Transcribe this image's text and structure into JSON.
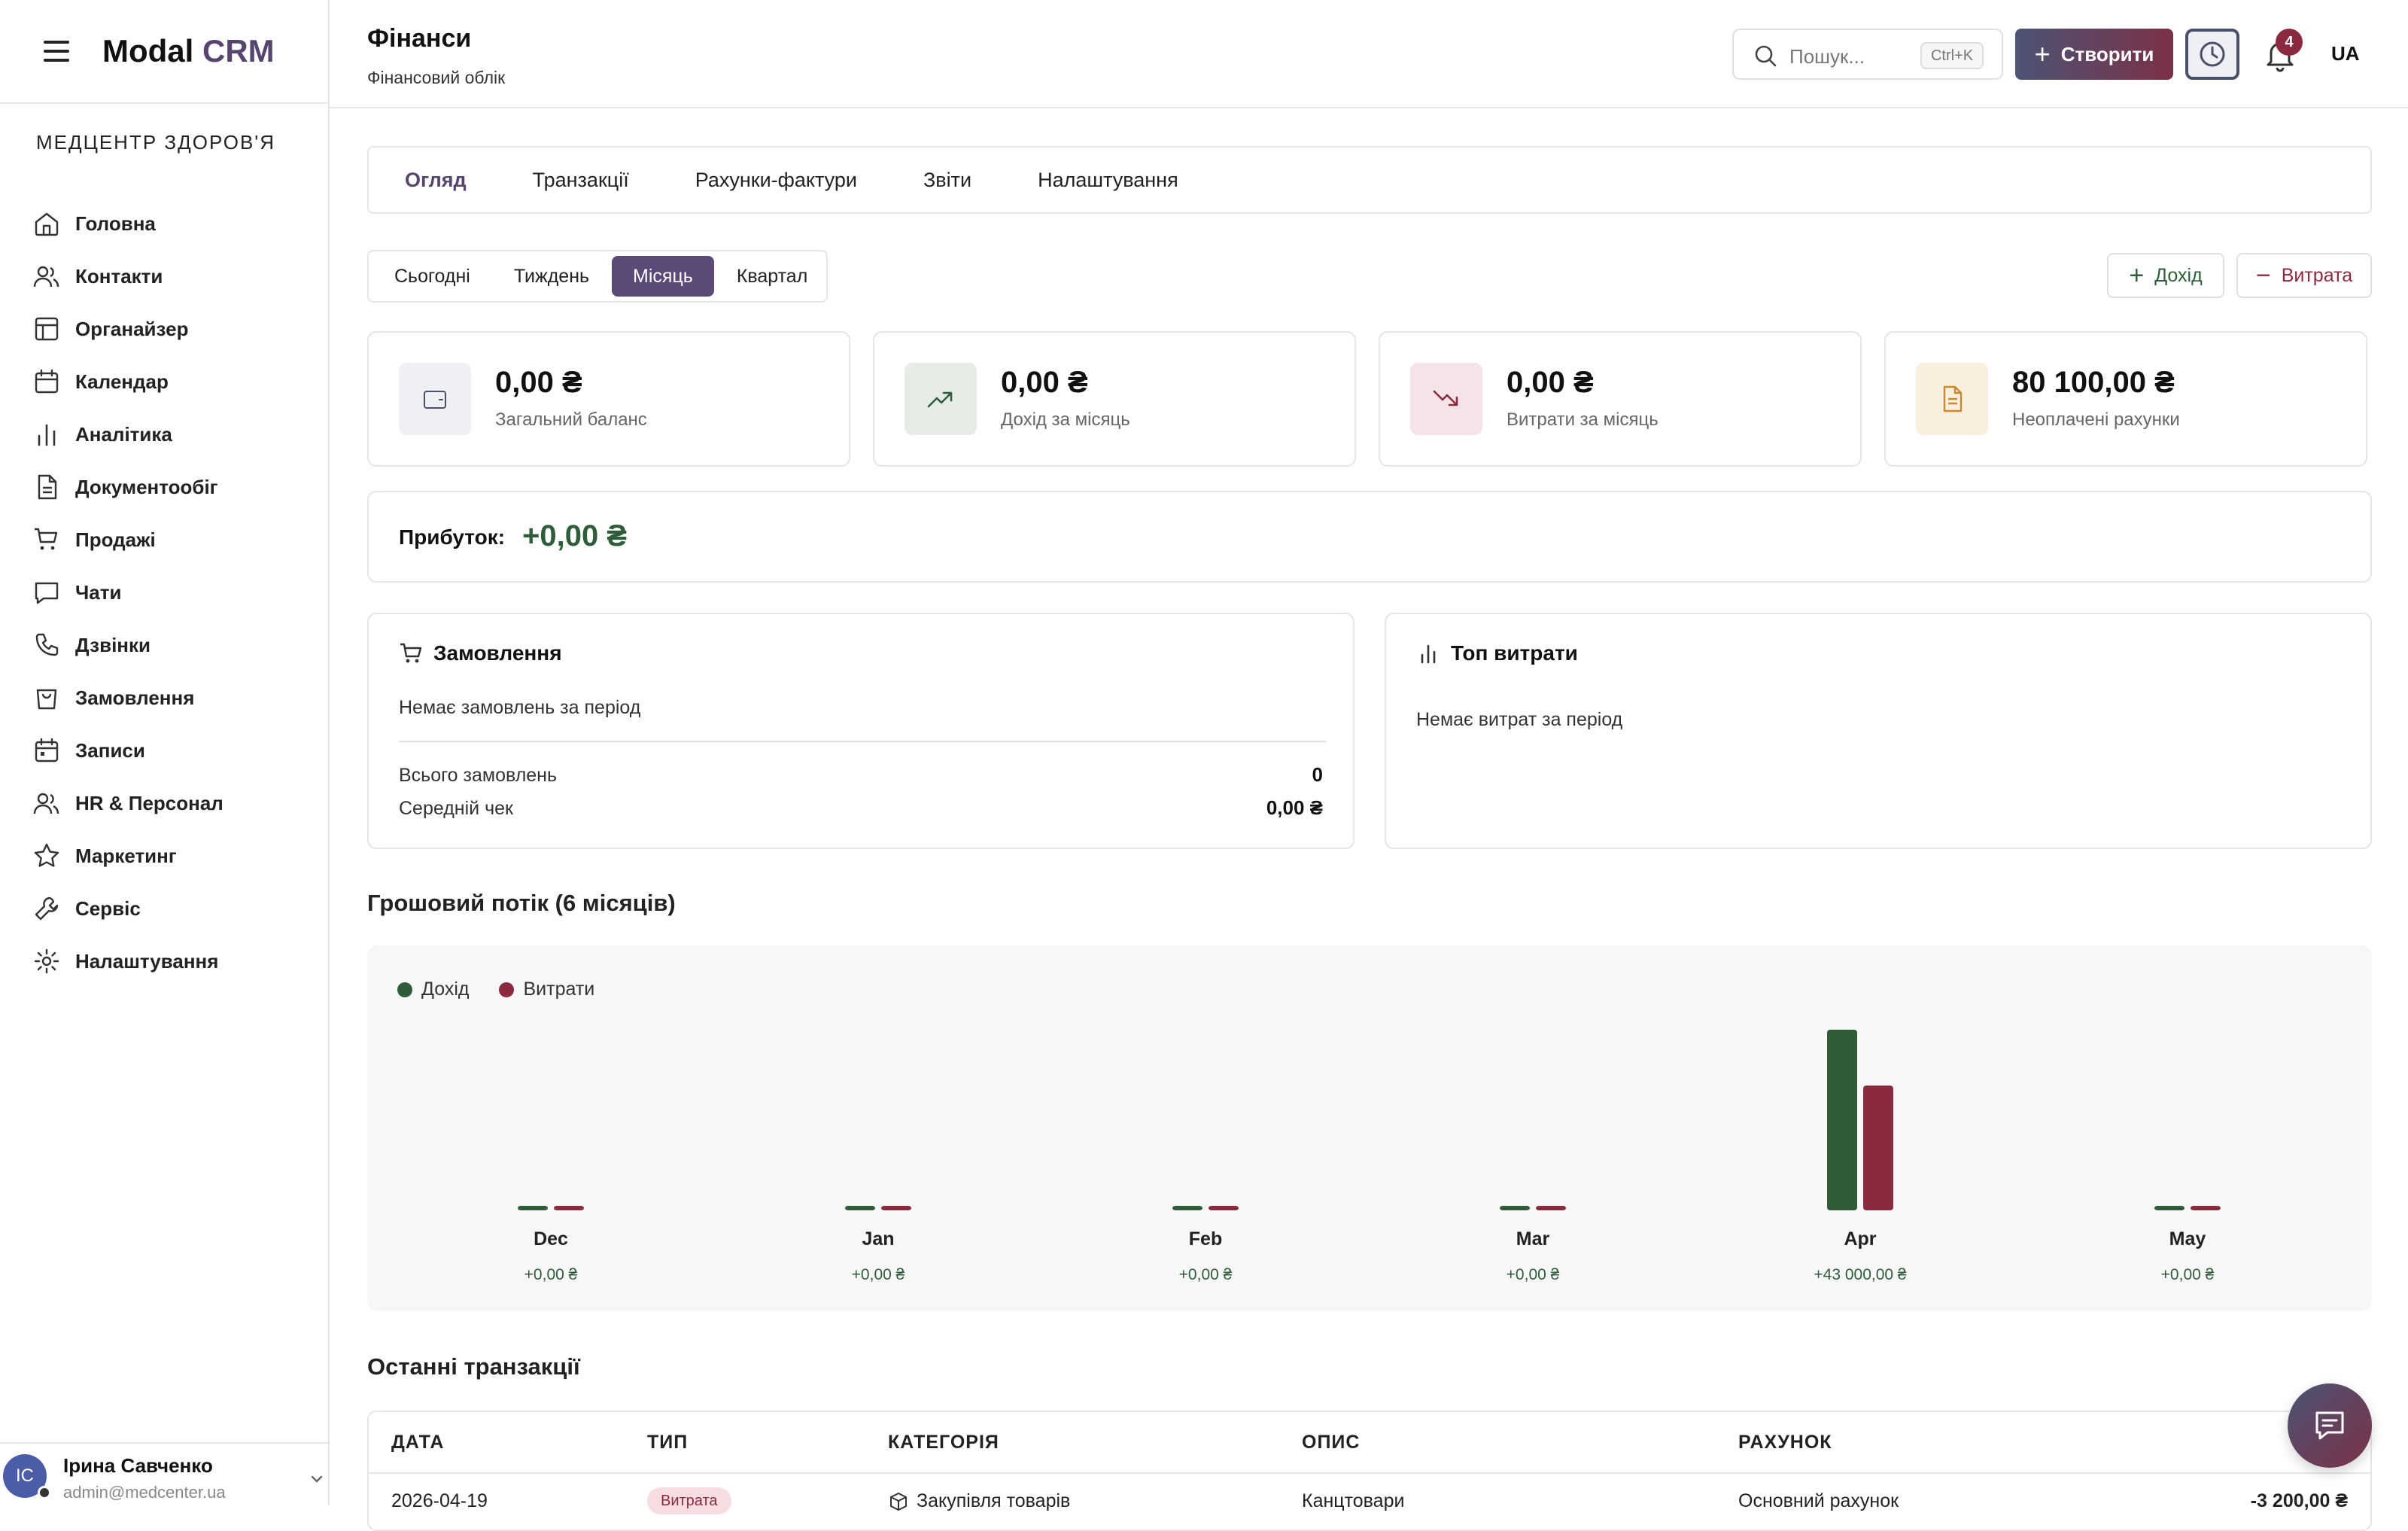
{
  "app": {
    "brand_main": "Modal",
    "brand_accent": "CRM",
    "org_name": "МЕДЦЕНТР ЗДОРОВ'Я"
  },
  "sidebar": {
    "items": [
      {
        "label": "Головна",
        "icon": "home-icon"
      },
      {
        "label": "Контакти",
        "icon": "users-icon"
      },
      {
        "label": "Органайзер",
        "icon": "layout-icon"
      },
      {
        "label": "Календар",
        "icon": "calendar-icon"
      },
      {
        "label": "Аналітика",
        "icon": "bar-chart-icon"
      },
      {
        "label": "Документообіг",
        "icon": "document-icon"
      },
      {
        "label": "Продажі",
        "icon": "cart-icon"
      },
      {
        "label": "Чати",
        "icon": "chat-icon"
      },
      {
        "label": "Дзвінки",
        "icon": "phone-icon"
      },
      {
        "label": "Замовлення",
        "icon": "shopping-bag-icon"
      },
      {
        "label": "Записи",
        "icon": "calendar-check-icon"
      },
      {
        "label": "HR & Персонал",
        "icon": "users-icon"
      },
      {
        "label": "Маркетинг",
        "icon": "star-icon"
      },
      {
        "label": "Сервіс",
        "icon": "wrench-icon"
      },
      {
        "label": "Налаштування",
        "icon": "gear-icon"
      }
    ]
  },
  "user": {
    "initials": "IC",
    "name": "Ірина Савченко",
    "email": "admin@medcenter.ua"
  },
  "header": {
    "title": "Фінанси",
    "subtitle": "Фінансовий облік",
    "search_placeholder": "Пошук...",
    "search_shortcut": "Ctrl+K",
    "create_label": "Створити",
    "notifications_count": "4",
    "language": "UA"
  },
  "tabs": [
    {
      "label": "Огляд",
      "active": true
    },
    {
      "label": "Транзакції",
      "active": false
    },
    {
      "label": "Рахунки-фактури",
      "active": false
    },
    {
      "label": "Звіти",
      "active": false
    },
    {
      "label": "Налаштування",
      "active": false
    }
  ],
  "periods": [
    {
      "label": "Сьогодні",
      "active": false
    },
    {
      "label": "Тиждень",
      "active": false
    },
    {
      "label": "Місяць",
      "active": true
    },
    {
      "label": "Квартал",
      "active": false
    }
  ],
  "actions": {
    "income_label": "Дохід",
    "expense_label": "Витрата"
  },
  "stats": [
    {
      "value": "0,00 ₴",
      "label": "Загальний баланс",
      "icon": "wallet-icon",
      "bg": "#eef0f4",
      "color": "#4a4f6a"
    },
    {
      "value": "0,00 ₴",
      "label": "Дохід за місяць",
      "icon": "trending-up-icon",
      "bg": "#e6ede7",
      "color": "#2f5d3a"
    },
    {
      "value": "0,00 ₴",
      "label": "Витрати за місяць",
      "icon": "trending-down-icon",
      "bg": "#f4e4e8",
      "color": "#8b2a3e"
    },
    {
      "value": "80 100,00 ₴",
      "label": "Неоплачені рахунки",
      "icon": "invoice-icon",
      "bg": "#faefdf",
      "color": "#c9892f"
    }
  ],
  "profit": {
    "label": "Прибуток:",
    "value": "+0,00 ₴"
  },
  "orders": {
    "title": "Замовлення",
    "empty": "Немає замовлень за період",
    "total_label": "Всього замовлень",
    "total_value": "0",
    "avg_label": "Середній чек",
    "avg_value": "0,00 ₴"
  },
  "top_expenses": {
    "title": "Топ витрати",
    "empty": "Немає витрат за період"
  },
  "cashflow_title": "Грошовий потік (6 місяців)",
  "colors": {
    "income": "#2f5d3a",
    "expense": "#8b2a3e",
    "accent": "#57456f"
  },
  "chart_data": {
    "type": "bar",
    "categories": [
      "Dec",
      "Jan",
      "Feb",
      "Mar",
      "Apr",
      "May"
    ],
    "series": [
      {
        "name": "Дохід",
        "values": [
          0,
          0,
          0,
          0,
          43000,
          0
        ]
      },
      {
        "name": "Витрати",
        "values": [
          0,
          0,
          0,
          0,
          29700,
          0
        ]
      }
    ],
    "net_labels": [
      "+0,00 ₴",
      "+0,00 ₴",
      "+0,00 ₴",
      "+0,00 ₴",
      "+43 000,00 ₴",
      "+0,00 ₴"
    ],
    "legend_position": "top-left",
    "grid": false
  },
  "transactions": {
    "title": "Останні транзакції",
    "columns": [
      "ДАТА",
      "ТИП",
      "КАТЕГОРІЯ",
      "ОПИС",
      "РАХУНОК"
    ],
    "rows": [
      {
        "date": "2026-04-19",
        "type": "Витрата",
        "category": "Закупівля товарів",
        "description": "Канцтовари",
        "account": "Основний рахунок",
        "amount": "-3 200,00 ₴"
      }
    ]
  }
}
